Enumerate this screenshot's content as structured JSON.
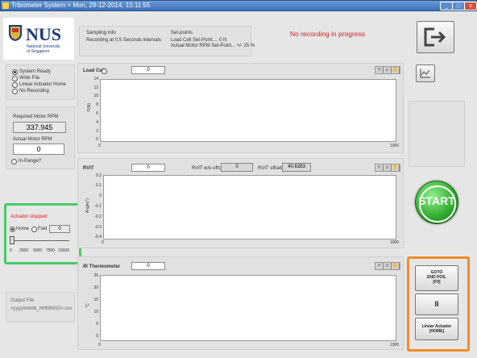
{
  "window": {
    "title": "Tribometer System > Mon, 29-12-2014, 15:11:55"
  },
  "logo": {
    "name": "NUS",
    "sub_line1": "National University",
    "sub_line2": "of Singapore"
  },
  "sampling": {
    "heading": "Sampling Info",
    "text": "Recording at 0.5 Seconds intervals"
  },
  "setpoints": {
    "heading": "Set-points",
    "line1": "Load Cell Set-Point.... 0 N",
    "line2": "Actual Motor RPM Set-Point... +/- 25 %"
  },
  "recording_status": "No recording in progress",
  "status_list": [
    "System Ready",
    "Write File",
    "Linear Actuator Home",
    "No Recording"
  ],
  "motor": {
    "required_label": "Required Motor RPM",
    "required_value": "337.945",
    "actual_label": "Actual Motor RPM",
    "actual_value": "0",
    "in_range_label": "In-Range?"
  },
  "actuator": {
    "status": "Actuator stopped",
    "home_label": "Home",
    "fwd_label": "Fwd",
    "value": "0",
    "slider_ticks": [
      "0",
      "2500",
      "5000",
      "7500",
      "10000"
    ]
  },
  "output_file": {
    "label": "Output File",
    "value": "<yyyymmdd_HHMMSS>.csv"
  },
  "load_cell": {
    "label": "Load Cell",
    "value": "0",
    "y_ticks": [
      "14",
      "12",
      "10",
      "8",
      "6",
      "4",
      "2",
      "0"
    ],
    "ylabel": "F(N)",
    "x_ticks": [
      "0",
      "1000"
    ]
  },
  "rvit": {
    "label": "RVIT",
    "value": "0",
    "offset_nb_label": "RVIT w/o offset",
    "offset_nb_value": "0",
    "offset_label": "RVIT offset",
    "offset_value": "40.6283",
    "y_ticks": [
      "0.2",
      "0.1",
      "0",
      "-0.1",
      "-0.2",
      "-0.3",
      "-0.4"
    ],
    "ylabel": "Angle(°)",
    "x_ticks": [
      "0",
      "1000"
    ]
  },
  "ir": {
    "label": "IR Thermometer",
    "value": "0",
    "y_ticks": [
      "25",
      "20",
      "15",
      "10",
      "5",
      "0"
    ],
    "ylabel": "°C",
    "x_ticks": [
      "0",
      "1000"
    ]
  },
  "buttons": {
    "start": "START",
    "goto_l1": "GOTO",
    "goto_l2": "END POS.",
    "goto_l3": "[F9]",
    "pause": "II",
    "home_l1": "Linear Actuator",
    "home_l2": "[HOME]"
  },
  "window_buttons": {
    "min": "_",
    "max": "□",
    "close": "x"
  },
  "zoom_glyphs": {
    "a": "+",
    "b": "⌕",
    "c": "✋"
  }
}
